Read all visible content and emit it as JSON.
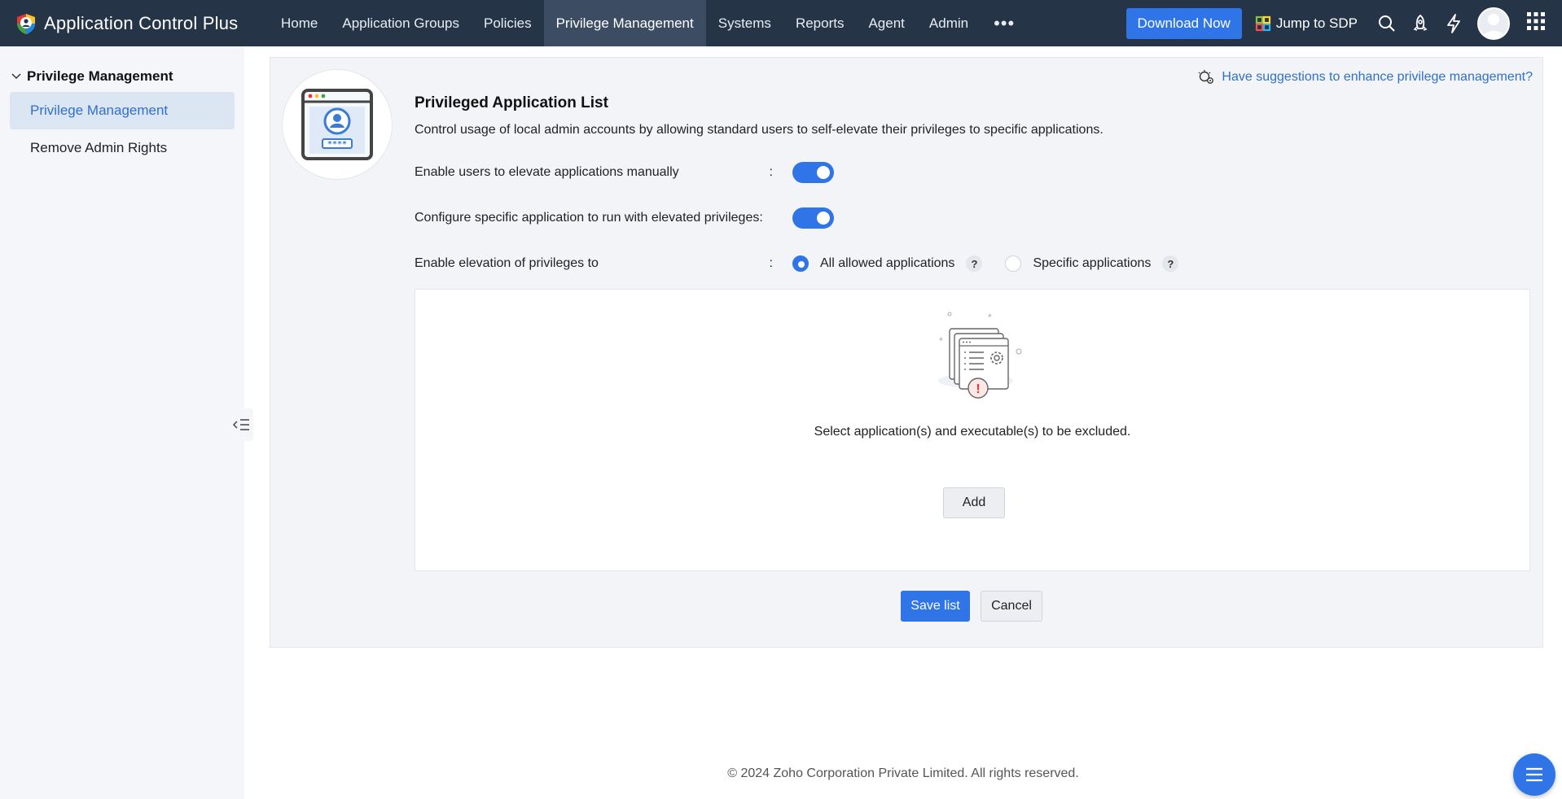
{
  "app": {
    "title": "Application Control Plus"
  },
  "nav": {
    "items": [
      {
        "label": "Home"
      },
      {
        "label": "Application Groups"
      },
      {
        "label": "Policies"
      },
      {
        "label": "Privilege Management",
        "active": true
      },
      {
        "label": "Systems"
      },
      {
        "label": "Reports"
      },
      {
        "label": "Agent"
      },
      {
        "label": "Admin"
      }
    ],
    "more": "•••"
  },
  "topbar": {
    "download_label": "Download Now",
    "jump_label": "Jump to SDP",
    "icons": [
      "search-icon",
      "rocket-icon",
      "lightning-icon",
      "avatar",
      "apps-grid-icon"
    ]
  },
  "sidebar": {
    "group_label": "Privilege Management",
    "items": [
      {
        "label": "Privilege Management",
        "active": true
      },
      {
        "label": "Remove Admin Rights"
      }
    ]
  },
  "main": {
    "suggestion_link": "Have suggestions to enhance privilege management?",
    "title": "Privileged Application List",
    "description": "Control usage of local admin accounts by allowing standard users to self-elevate their privileges to specific applications.",
    "settings": {
      "manual_label": "Enable users to elevate applications manually",
      "manual_enabled": true,
      "specific_label": "Configure specific application to run with elevated privileges:",
      "specific_enabled": true,
      "elevation_label": "Enable elevation of privileges to",
      "colon": ":",
      "options": [
        {
          "label": "All allowed applications",
          "selected": true
        },
        {
          "label": "Specific applications",
          "selected": false
        }
      ],
      "help": "?"
    },
    "empty_state": {
      "message": "Select application(s) and executable(s) to be excluded.",
      "add_label": "Add"
    },
    "save_label": "Save list",
    "cancel_label": "Cancel"
  },
  "footer": {
    "copyright": "© 2024 Zoho Corporation Private Limited. All rights reserved."
  },
  "colors": {
    "topbar": "#263447",
    "accent": "#2f75e8",
    "link": "#2f6fcf"
  }
}
